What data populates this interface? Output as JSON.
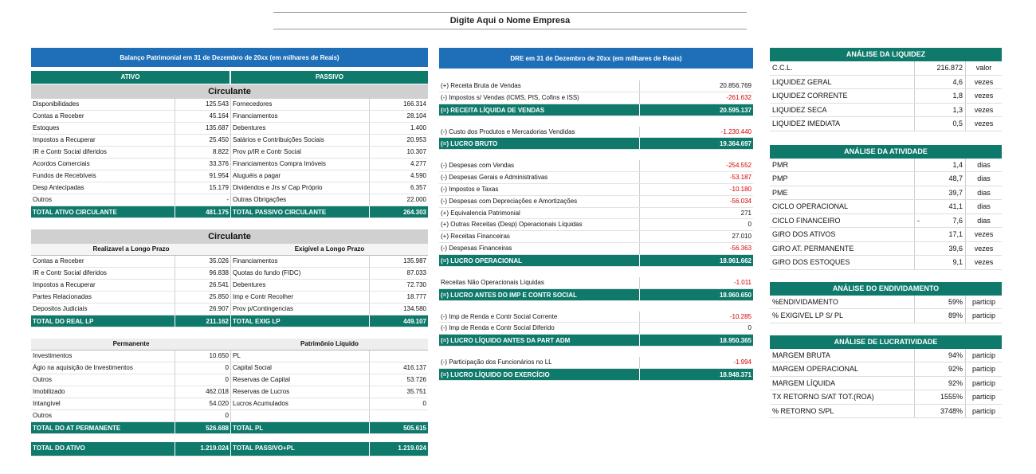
{
  "company_title": "Digite Aqui o Nome Empresa",
  "balanco": {
    "title": "Balanço Patrimonial em 31 de Dezembro de 20xx (em milhares de Reais)",
    "ativo_label": "ATIVO",
    "passivo_label": "PASSIVO",
    "circulante_label": "Circulante",
    "circ_rows": [
      [
        "Disponibilidades",
        "125.543",
        "Fornecedores",
        "166.314"
      ],
      [
        "Contas a Receber",
        "45.164",
        "Financiamentos",
        "28.104"
      ],
      [
        "Estoques",
        "135.687",
        "Debentures",
        "1.400"
      ],
      [
        "Impostos a Recuperar",
        "25.450",
        "Salários e Contribuições Sociais",
        "20.953"
      ],
      [
        "IR e Contr Social diferidos",
        "8.822",
        "Prov p/IR e Contr Social",
        "10.307"
      ],
      [
        "Acordos Comerciais",
        "33.376",
        "Financiamentos Compra Imóveis",
        "4.277"
      ],
      [
        "Fundos de Recebíveis",
        "91.954",
        "Aluguéis a pagar",
        "4.590"
      ],
      [
        "Desp Antecipadas",
        "15.179",
        "Dividendos e Jrs s/ Cap Próprio",
        "6.357"
      ],
      [
        "Outros",
        "-",
        "Outras Obrigações",
        "22.000"
      ]
    ],
    "circ_total": [
      "TOTAL ATIVO CIRCULANTE",
      "481.175",
      "TOTAL PASSIVO CIRCULANTE",
      "264.303"
    ],
    "lp_label": "Circulante",
    "rlp_label": "Realizavel a Longo Prazo",
    "elp_label": "Exigível a Longo Prazo",
    "lp_rows": [
      [
        "Contas a Receber",
        "35.026",
        "Financiamentos",
        "135.987"
      ],
      [
        "IR e Contr Social diferidos",
        "96.838",
        "Quotas do fundo (FIDC)",
        "87.033"
      ],
      [
        "Impostos a Recuperar",
        "26.541",
        "Debentures",
        "72.730"
      ],
      [
        "Partes Relacionadas",
        "25.850",
        "Imp e Contr Recolher",
        "18.777"
      ],
      [
        "Depositos Judiciais",
        "26.907",
        "Prov p/Contingencias",
        "134.580"
      ]
    ],
    "lp_total": [
      "TOTAL DO REAL LP",
      "211.162",
      "TOTAL EXIG LP",
      "449.107"
    ],
    "perm_label": "Permanente",
    "pl_label": "Patrimônio Líquido",
    "perm_rows": [
      [
        "Investimentos",
        "10.650",
        "PL",
        ""
      ],
      [
        "Ágio na aquisição de Investimentos",
        "0",
        "Capital Social",
        "416.137"
      ],
      [
        "Outros",
        "0",
        "Reservas de Capital",
        "53.726"
      ],
      [
        "Imobilizado",
        "462.018",
        "Reservas de Lucros",
        "35.751"
      ],
      [
        "Intangível",
        "54.020",
        "Lucros Acumulados",
        "0"
      ],
      [
        "Outros",
        "0",
        "",
        ""
      ]
    ],
    "perm_total": [
      "TOTAL DO AT PERMANENTE",
      "526.688",
      "TOTAL PL",
      "505.615"
    ],
    "grand_total": [
      "TOTAL DO ATIVO",
      "1.219.024",
      "TOTAL PASSIVO+PL",
      "1.219.024"
    ]
  },
  "dre": {
    "title": "DRE em 31 de Dezembro de 20xx (em milhares de Reais)",
    "groups": [
      [
        [
          "(+) Receita Bruta de Vendas",
          "20.856.769",
          false
        ],
        [
          "(-) Impostos s/ Vendas (ICMS, PIS, Cofins e ISS)",
          "-261.632",
          false
        ],
        [
          "(=) RECEITA LÍQUIDA DE VENDAS",
          "20.595.137",
          true
        ]
      ],
      [
        [
          "(-) Custo dos Produtos e Mercadorias Vendidas",
          "-1.230.440",
          false
        ],
        [
          "(=) LUCRO BRUTO",
          "19.364.697",
          true
        ]
      ],
      [
        [
          "(-) Despesas com Vendas",
          "-254.552",
          false
        ],
        [
          "(-) Despesas Gerais e Administrativas",
          "-53.187",
          false
        ],
        [
          "(-) Impostos e Taxas",
          "-10.180",
          false
        ],
        [
          "(-) Despesas com Depreciações e Amortizações",
          "-56.034",
          false
        ],
        [
          "(+) Equivalencia Patrimonial",
          "271",
          false
        ],
        [
          "(+) Outras Receitas (Desp) Operacionais Líquidas",
          "0",
          false
        ],
        [
          "(+) Receitas Financeiras",
          "27.010",
          false
        ],
        [
          "(-) Despesas Financeiras",
          "-56.363",
          false
        ],
        [
          "(=) LUCRO OPERACIONAL",
          "18.961.662",
          true
        ]
      ],
      [
        [
          "Receitas Não Operacionais Líquidas",
          "-1.011",
          false
        ],
        [
          "(=) LUCRO ANTES DO IMP E CONTR SOCIAL",
          "18.960.650",
          true
        ]
      ],
      [
        [
          "(-) Imp de Renda e Contr Social Corrente",
          "-10.285",
          false
        ],
        [
          "(-) Imp de Renda e Contr Social Diferido",
          "0",
          false
        ],
        [
          "(=) LUCRO LÍQUIDO ANTES DA PART ADM",
          "18.950.365",
          true
        ]
      ],
      [
        [
          "(-) Participação dos Funcionários no LL",
          "-1.994",
          false
        ],
        [
          "(=) LUCRO LÍQUIDO DO EXERCÍCIO",
          "18.948.371",
          true
        ]
      ]
    ]
  },
  "panels": [
    {
      "title": "ANÁLISE DA LIQUIDEZ",
      "rows": [
        [
          "C.C.L.",
          "",
          "216.872",
          "valor"
        ],
        [
          "LIQUIDEZ GERAL",
          "",
          "4,6",
          "vezes"
        ],
        [
          "LIQUIDEZ CORRENTE",
          "",
          "1,8",
          "vezes"
        ],
        [
          "LIQUIDEZ SECA",
          "",
          "1,3",
          "vezes"
        ],
        [
          "LIQUIDEZ IMEDIATA",
          "",
          "0,5",
          "vezes"
        ]
      ]
    },
    {
      "title": "ANÁLISE DA ATIVIDADE",
      "rows": [
        [
          "PMR",
          "",
          "1,4",
          "dias"
        ],
        [
          "PMP",
          "",
          "48,7",
          "dias"
        ],
        [
          "PME",
          "",
          "39,7",
          "dias"
        ],
        [
          "CICLO OPERACIONAL",
          "",
          "41,1",
          "dias"
        ],
        [
          "CICLO FINANCEIRO",
          "-",
          "7,6",
          "dias"
        ],
        [
          "GIRO DOS ATIVOS",
          "",
          "17,1",
          "vezes"
        ],
        [
          "GIRO AT. PERMANENTE",
          "",
          "39,6",
          "vezes"
        ],
        [
          "GIRO DOS ESTOQUES",
          "",
          "9,1",
          "vezes"
        ]
      ]
    },
    {
      "title": "ANÁLISE DO ENDIVIDAMENTO",
      "rows": [
        [
          "%ENDIVIDAMENTO",
          "",
          "59%",
          "particip"
        ],
        [
          "% EXIGIVEL LP S/ PL",
          "",
          "89%",
          "particip"
        ]
      ]
    },
    {
      "title": "ANÁLISE DE LUCRATIVIDADE",
      "rows": [
        [
          "MARGEM BRUTA",
          "",
          "94%",
          "particip"
        ],
        [
          "MARGEM OPERACIONAL",
          "",
          "92%",
          "particip"
        ],
        [
          "MARGEM LÍQUIDA",
          "",
          "92%",
          "particip"
        ],
        [
          "TX RETORNO S/AT TOT.(ROA)",
          "",
          "1555%",
          "particip"
        ],
        [
          "% RETORNO S/PL",
          "",
          "3748%",
          "particip"
        ]
      ]
    }
  ]
}
